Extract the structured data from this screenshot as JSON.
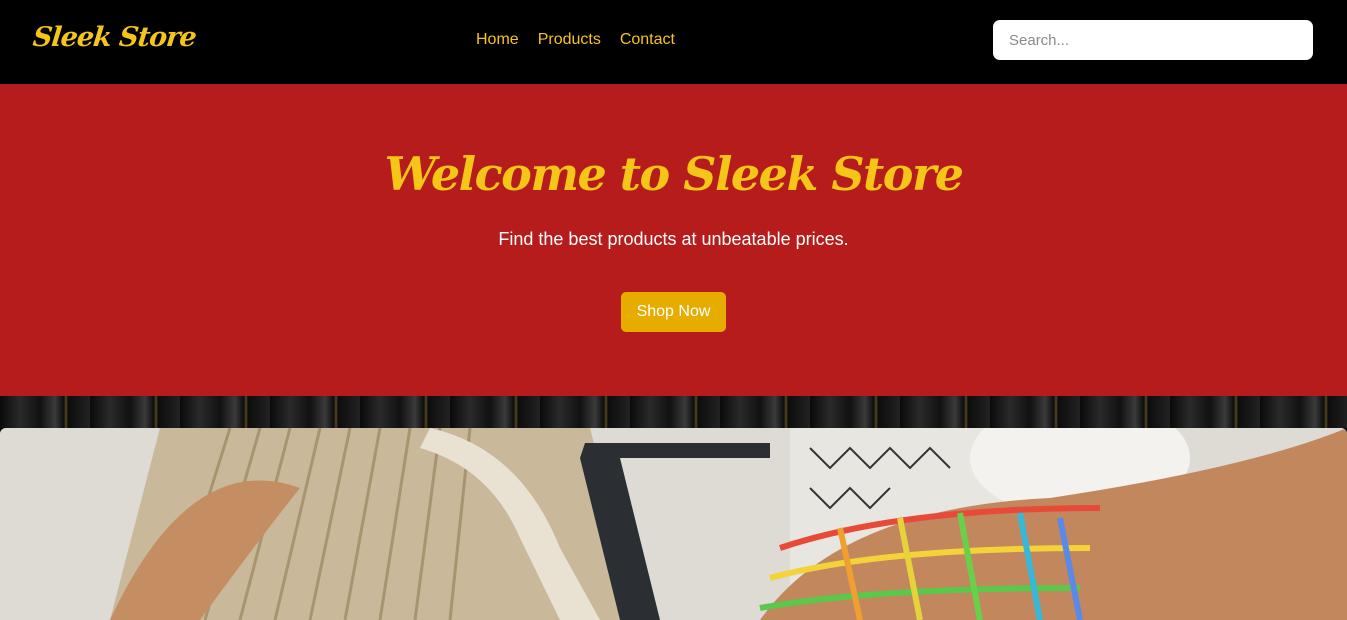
{
  "brand": {
    "logo_text": "Sleek Store"
  },
  "nav": {
    "links": [
      {
        "label": "Home"
      },
      {
        "label": "Products"
      },
      {
        "label": "Contact"
      }
    ]
  },
  "search": {
    "placeholder": "Search...",
    "value": ""
  },
  "hero": {
    "title": "Welcome to Sleek Store",
    "subtitle": "Find the best products at unbeatable prices.",
    "cta_label": "Shop Now"
  },
  "colors": {
    "nav_bg": "#000000",
    "accent_gold": "#f5c518",
    "hero_bg": "#b71c1c",
    "button_bg": "#e6ac00",
    "button_text": "#ffffff"
  },
  "product_image": {
    "icon": "product-photo"
  }
}
